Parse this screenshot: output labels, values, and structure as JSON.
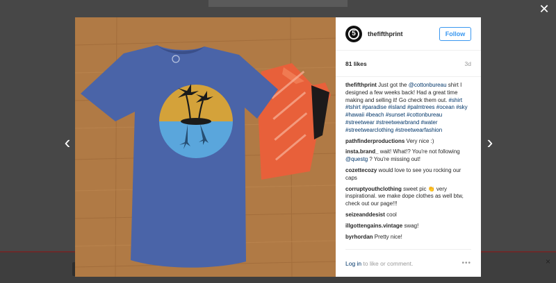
{
  "backdrop": {
    "lower_close": "×"
  },
  "modal": {
    "close": "✕",
    "prev": "‹",
    "next": "›"
  },
  "post": {
    "avatar_glyph": "5",
    "username": "thefifthprint",
    "follow_label": "Follow",
    "likes": "81 likes",
    "time": "3d",
    "caption": {
      "user": "thefifthprint",
      "text1": "Just got the ",
      "mention": "@cottonbureau",
      "text2": " shirt I designed a few weeks back! Had a great time making and selling it! Go check them out. ",
      "hashtags": "#shirt #tshirt #paradise #island #palmtrees #ocean #sky #hawaii #beach #sunset #cottonbureau #streetwear #streetwearbrand #water #streetwearclothing #streetwearfashion"
    },
    "comments": [
      {
        "user": "pathfinderproductions",
        "text": " Very nice :)"
      },
      {
        "user": "insta.brand_",
        "text": " wait! What!? You're not following ",
        "mention": "@questg",
        "text_after": " ? You're missing out!"
      },
      {
        "user": "cozettecozy",
        "text": " would love to see you rocking our caps"
      },
      {
        "user": "corruptyouthclothing",
        "text": " sweet pic 👏 very inspirational. we make dope clothes as well btw, check out our page!!!"
      },
      {
        "user": "seizeanddesist",
        "text": " cool"
      },
      {
        "user": "illgottengains.vintage",
        "text": " swag!"
      },
      {
        "user": "byrhordan",
        "text": " Pretty nice!"
      }
    ],
    "footer": {
      "login_label": "Log in",
      "login_suffix": " to like or comment.",
      "more": "•••"
    }
  },
  "colors": {
    "link": "#003569",
    "follow": "#3897f0",
    "shirt": "#4a64a8",
    "floor": "#b07a45",
    "mailer": "#e8603a",
    "sun": "#d4a23a",
    "sea": "#5aa6dc"
  }
}
